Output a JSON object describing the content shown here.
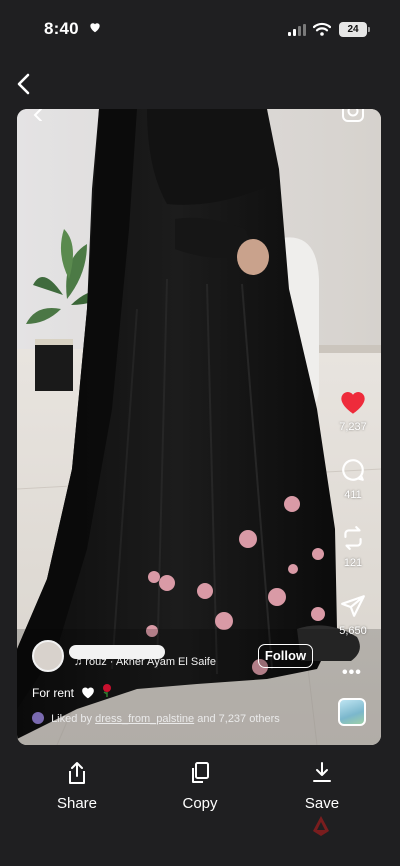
{
  "status_bar": {
    "time": "8:40",
    "battery": "24"
  },
  "post": {
    "music": "♫ rouz · Akher Ayam El Saife",
    "follow_label": "Follow",
    "caption_text": "For rent",
    "liked_prefix": "Liked by",
    "liked_user": "dress_from_palstine",
    "liked_suffix": "and 7,237 others",
    "likes_count": "7,237",
    "comments_count": "411",
    "reposts_count": "121",
    "shares_count": "5,650",
    "more": "•••"
  },
  "toolbar": {
    "share_label": "Share",
    "copy_label": "Copy",
    "save_label": "Save"
  },
  "colors": {
    "background": "#1f1f21",
    "like_red": "#ee2b3b",
    "garment_black": "#111111",
    "flower_pink": "#d99aa6"
  },
  "icons": [
    "heart-icon",
    "comment-icon",
    "repost-icon",
    "send-icon",
    "share-icon",
    "copy-icon",
    "save-icon",
    "back-icon",
    "camera-icon"
  ]
}
